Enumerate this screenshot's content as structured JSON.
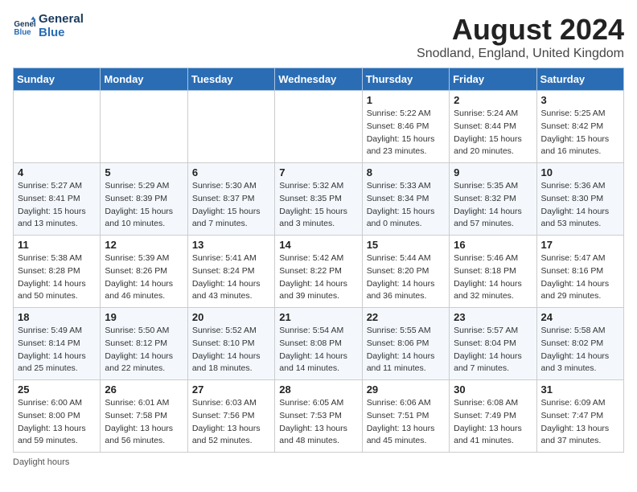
{
  "header": {
    "logo_line1": "General",
    "logo_line2": "Blue",
    "month_title": "August 2024",
    "location": "Snodland, England, United Kingdom"
  },
  "days_of_week": [
    "Sunday",
    "Monday",
    "Tuesday",
    "Wednesday",
    "Thursday",
    "Friday",
    "Saturday"
  ],
  "footer_note": "Daylight hours",
  "weeks": [
    [
      {
        "day": "",
        "info": ""
      },
      {
        "day": "",
        "info": ""
      },
      {
        "day": "",
        "info": ""
      },
      {
        "day": "",
        "info": ""
      },
      {
        "day": "1",
        "info": "Sunrise: 5:22 AM\nSunset: 8:46 PM\nDaylight: 15 hours\nand 23 minutes."
      },
      {
        "day": "2",
        "info": "Sunrise: 5:24 AM\nSunset: 8:44 PM\nDaylight: 15 hours\nand 20 minutes."
      },
      {
        "day": "3",
        "info": "Sunrise: 5:25 AM\nSunset: 8:42 PM\nDaylight: 15 hours\nand 16 minutes."
      }
    ],
    [
      {
        "day": "4",
        "info": "Sunrise: 5:27 AM\nSunset: 8:41 PM\nDaylight: 15 hours\nand 13 minutes."
      },
      {
        "day": "5",
        "info": "Sunrise: 5:29 AM\nSunset: 8:39 PM\nDaylight: 15 hours\nand 10 minutes."
      },
      {
        "day": "6",
        "info": "Sunrise: 5:30 AM\nSunset: 8:37 PM\nDaylight: 15 hours\nand 7 minutes."
      },
      {
        "day": "7",
        "info": "Sunrise: 5:32 AM\nSunset: 8:35 PM\nDaylight: 15 hours\nand 3 minutes."
      },
      {
        "day": "8",
        "info": "Sunrise: 5:33 AM\nSunset: 8:34 PM\nDaylight: 15 hours\nand 0 minutes."
      },
      {
        "day": "9",
        "info": "Sunrise: 5:35 AM\nSunset: 8:32 PM\nDaylight: 14 hours\nand 57 minutes."
      },
      {
        "day": "10",
        "info": "Sunrise: 5:36 AM\nSunset: 8:30 PM\nDaylight: 14 hours\nand 53 minutes."
      }
    ],
    [
      {
        "day": "11",
        "info": "Sunrise: 5:38 AM\nSunset: 8:28 PM\nDaylight: 14 hours\nand 50 minutes."
      },
      {
        "day": "12",
        "info": "Sunrise: 5:39 AM\nSunset: 8:26 PM\nDaylight: 14 hours\nand 46 minutes."
      },
      {
        "day": "13",
        "info": "Sunrise: 5:41 AM\nSunset: 8:24 PM\nDaylight: 14 hours\nand 43 minutes."
      },
      {
        "day": "14",
        "info": "Sunrise: 5:42 AM\nSunset: 8:22 PM\nDaylight: 14 hours\nand 39 minutes."
      },
      {
        "day": "15",
        "info": "Sunrise: 5:44 AM\nSunset: 8:20 PM\nDaylight: 14 hours\nand 36 minutes."
      },
      {
        "day": "16",
        "info": "Sunrise: 5:46 AM\nSunset: 8:18 PM\nDaylight: 14 hours\nand 32 minutes."
      },
      {
        "day": "17",
        "info": "Sunrise: 5:47 AM\nSunset: 8:16 PM\nDaylight: 14 hours\nand 29 minutes."
      }
    ],
    [
      {
        "day": "18",
        "info": "Sunrise: 5:49 AM\nSunset: 8:14 PM\nDaylight: 14 hours\nand 25 minutes."
      },
      {
        "day": "19",
        "info": "Sunrise: 5:50 AM\nSunset: 8:12 PM\nDaylight: 14 hours\nand 22 minutes."
      },
      {
        "day": "20",
        "info": "Sunrise: 5:52 AM\nSunset: 8:10 PM\nDaylight: 14 hours\nand 18 minutes."
      },
      {
        "day": "21",
        "info": "Sunrise: 5:54 AM\nSunset: 8:08 PM\nDaylight: 14 hours\nand 14 minutes."
      },
      {
        "day": "22",
        "info": "Sunrise: 5:55 AM\nSunset: 8:06 PM\nDaylight: 14 hours\nand 11 minutes."
      },
      {
        "day": "23",
        "info": "Sunrise: 5:57 AM\nSunset: 8:04 PM\nDaylight: 14 hours\nand 7 minutes."
      },
      {
        "day": "24",
        "info": "Sunrise: 5:58 AM\nSunset: 8:02 PM\nDaylight: 14 hours\nand 3 minutes."
      }
    ],
    [
      {
        "day": "25",
        "info": "Sunrise: 6:00 AM\nSunset: 8:00 PM\nDaylight: 13 hours\nand 59 minutes."
      },
      {
        "day": "26",
        "info": "Sunrise: 6:01 AM\nSunset: 7:58 PM\nDaylight: 13 hours\nand 56 minutes."
      },
      {
        "day": "27",
        "info": "Sunrise: 6:03 AM\nSunset: 7:56 PM\nDaylight: 13 hours\nand 52 minutes."
      },
      {
        "day": "28",
        "info": "Sunrise: 6:05 AM\nSunset: 7:53 PM\nDaylight: 13 hours\nand 48 minutes."
      },
      {
        "day": "29",
        "info": "Sunrise: 6:06 AM\nSunset: 7:51 PM\nDaylight: 13 hours\nand 45 minutes."
      },
      {
        "day": "30",
        "info": "Sunrise: 6:08 AM\nSunset: 7:49 PM\nDaylight: 13 hours\nand 41 minutes."
      },
      {
        "day": "31",
        "info": "Sunrise: 6:09 AM\nSunset: 7:47 PM\nDaylight: 13 hours\nand 37 minutes."
      }
    ]
  ]
}
